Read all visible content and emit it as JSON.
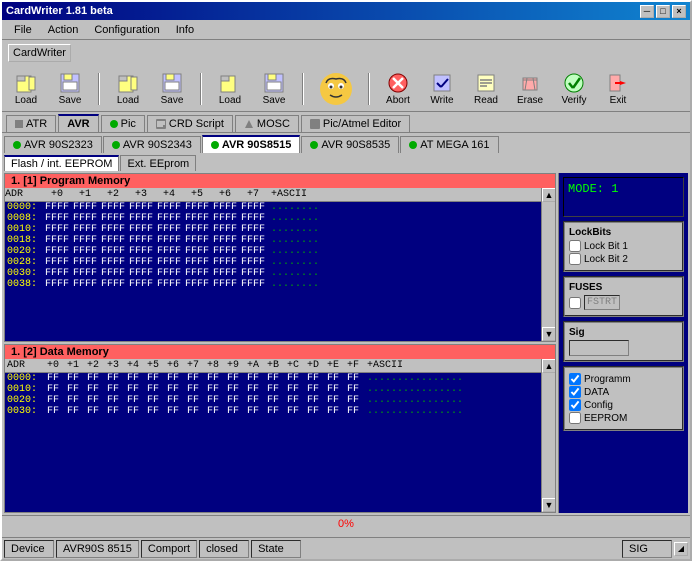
{
  "window": {
    "title": "CardWriter 1.81 beta",
    "close_btn": "×",
    "min_btn": "─",
    "max_btn": "□"
  },
  "menu": {
    "items": [
      "File",
      "Action",
      "Configuration",
      "Info"
    ]
  },
  "toolbar_tab": "CardWriter",
  "toolbar": {
    "buttons": [
      {
        "label": "Load",
        "icon": "📂"
      },
      {
        "label": "Save",
        "icon": "💾"
      },
      {
        "label": "Load",
        "icon": "📂"
      },
      {
        "label": "Save",
        "icon": "💾"
      },
      {
        "label": "Load",
        "icon": "📂"
      },
      {
        "label": "Save",
        "icon": "💾"
      },
      {
        "label": "Abort",
        "icon": "🚫"
      },
      {
        "label": "Write",
        "icon": "✏️"
      },
      {
        "label": "Read",
        "icon": "📖"
      },
      {
        "label": "Erase",
        "icon": "🗑️"
      },
      {
        "label": "Verify",
        "icon": "✅"
      },
      {
        "label": "Exit",
        "icon": "🚪"
      }
    ]
  },
  "device_tabs": [
    {
      "label": "ATR",
      "active": false
    },
    {
      "label": "AVR",
      "active": false
    },
    {
      "label": "Pic",
      "active": false
    },
    {
      "label": "CRD Script",
      "active": false
    },
    {
      "label": "MOSC",
      "active": false
    },
    {
      "label": "Pic/Atmel Editor",
      "active": false
    }
  ],
  "avr_tabs": [
    {
      "label": "AVR 90S2323",
      "active": false
    },
    {
      "label": "AVR 90S2343",
      "active": false
    },
    {
      "label": "AVR 90S8515",
      "active": true
    },
    {
      "label": "AVR 90S8535",
      "active": false
    },
    {
      "label": "AT MEGA 161",
      "active": false
    }
  ],
  "memory_tabs": [
    {
      "label": "Flash / int. EEPROM",
      "active": true
    },
    {
      "label": "Ext. EEprom",
      "active": false
    }
  ],
  "program_memory": {
    "header": "1. [1] Program Memory",
    "cols": [
      "ADR",
      "+0",
      "+1",
      "+2",
      "+3",
      "+4",
      "+5",
      "+6",
      "+7",
      "+ASCII"
    ],
    "rows": [
      {
        "adr": "0000:",
        "vals": [
          "FFFF",
          "FFFF",
          "FFFF",
          "FFFF",
          "FFFF",
          "FFFF",
          "FFFF",
          "FFFF"
        ],
        "ascii": "........"
      },
      {
        "adr": "0008:",
        "vals": [
          "FFFF",
          "FFFF",
          "FFFF",
          "FFFF",
          "FFFF",
          "FFFF",
          "FFFF",
          "FFFF"
        ],
        "ascii": "........"
      },
      {
        "adr": "0010:",
        "vals": [
          "FFFF",
          "FFFF",
          "FFFF",
          "FFFF",
          "FFFF",
          "FFFF",
          "FFFF",
          "FFFF"
        ],
        "ascii": "........"
      },
      {
        "adr": "0018:",
        "vals": [
          "FFFF",
          "FFFF",
          "FFFF",
          "FFFF",
          "FFFF",
          "FFFF",
          "FFFF",
          "FFFF"
        ],
        "ascii": "........"
      },
      {
        "adr": "0020:",
        "vals": [
          "FFFF",
          "FFFF",
          "FFFF",
          "FFFF",
          "FFFF",
          "FFFF",
          "FFFF",
          "FFFF"
        ],
        "ascii": "........"
      },
      {
        "adr": "0028:",
        "vals": [
          "FFFF",
          "FFFF",
          "FFFF",
          "FFFF",
          "FFFF",
          "FFFF",
          "FFFF",
          "FFFF"
        ],
        "ascii": "........"
      },
      {
        "adr": "0030:",
        "vals": [
          "FFFF",
          "FFFF",
          "FFFF",
          "FFFF",
          "FFFF",
          "FFFF",
          "FFFF",
          "FFFF"
        ],
        "ascii": "........"
      },
      {
        "adr": "0038:",
        "vals": [
          "FFFF",
          "FFFF",
          "FFFF",
          "FFFF",
          "FFFF",
          "FFFF",
          "FFFF",
          "FFFF"
        ],
        "ascii": "........"
      }
    ]
  },
  "data_memory": {
    "header": "1. [2] Data Memory",
    "cols": [
      "ADR",
      "+0",
      "+1",
      "+2",
      "+3",
      "+4",
      "+5",
      "+6",
      "+7",
      "+8",
      "+9",
      "+A",
      "+B",
      "+C",
      "+D",
      "+E",
      "+F",
      "+ASCII"
    ],
    "rows": [
      {
        "adr": "0000:",
        "vals": [
          "FF",
          "FF",
          "FF",
          "FF",
          "FF",
          "FF",
          "FF",
          "FF",
          "FF",
          "FF",
          "FF",
          "FF",
          "FF",
          "FF",
          "FF",
          "FF"
        ],
        "ascii": "................"
      },
      {
        "adr": "0010:",
        "vals": [
          "FF",
          "FF",
          "FF",
          "FF",
          "FF",
          "FF",
          "FF",
          "FF",
          "FF",
          "FF",
          "FF",
          "FF",
          "FF",
          "FF",
          "FF",
          "FF"
        ],
        "ascii": "................"
      },
      {
        "adr": "0020:",
        "vals": [
          "FF",
          "FF",
          "FF",
          "FF",
          "FF",
          "FF",
          "FF",
          "FF",
          "FF",
          "FF",
          "FF",
          "FF",
          "FF",
          "FF",
          "FF",
          "FF"
        ],
        "ascii": "................"
      },
      {
        "adr": "0030:",
        "vals": [
          "FF",
          "FF",
          "FF",
          "FF",
          "FF",
          "FF",
          "FF",
          "FF",
          "FF",
          "FF",
          "FF",
          "FF",
          "FF",
          "FF",
          "FF",
          "FF"
        ],
        "ascii": "................"
      }
    ]
  },
  "right_panel": {
    "mode_text": "MODE: 1",
    "lockbits": {
      "title": "LockBits",
      "items": [
        "Lock Bit 1",
        "Lock Bit 2"
      ]
    },
    "fuses": {
      "title": "FUSES",
      "display": "FSTRT",
      "checked": false
    },
    "sig": {
      "label": "Sig",
      "value": ""
    },
    "checkboxes": [
      {
        "label": "Programm",
        "checked": true
      },
      {
        "label": "DATA",
        "checked": true
      },
      {
        "label": "Config",
        "checked": true
      },
      {
        "label": "EEPROM",
        "checked": false
      }
    ]
  },
  "progress": {
    "label": "0%",
    "value": 0
  },
  "status_bar": {
    "items": [
      "Device",
      "AVR90S 8515",
      "Comport",
      "closed",
      "State"
    ],
    "right": "SIG"
  }
}
